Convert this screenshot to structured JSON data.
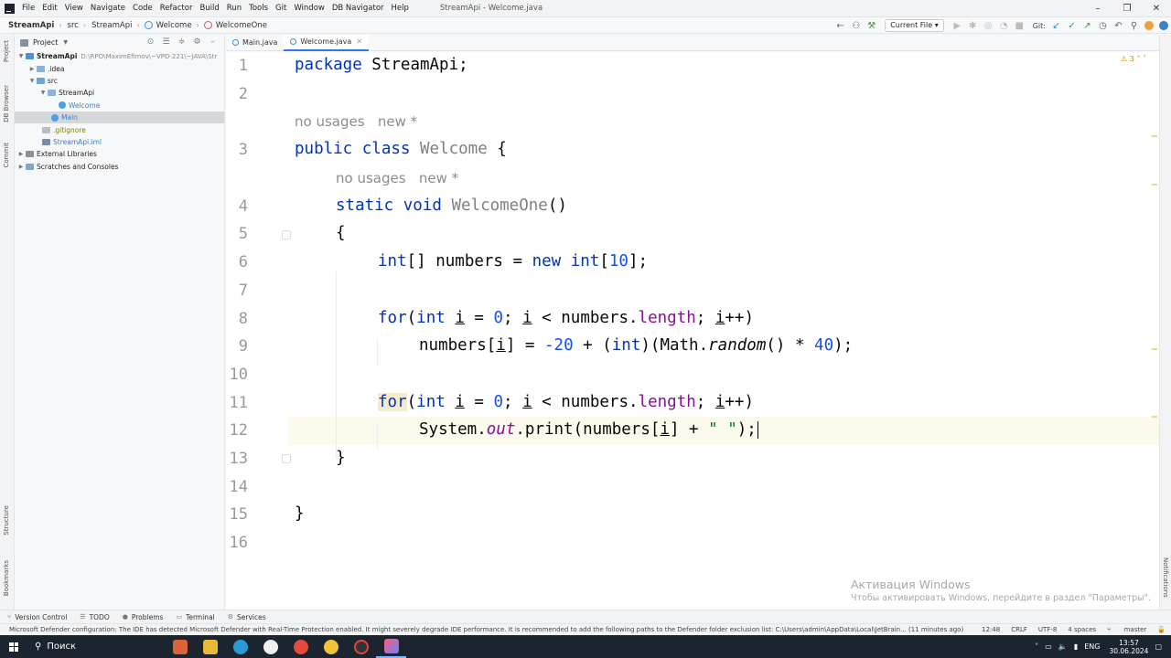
{
  "menubar": {
    "items": [
      "File",
      "Edit",
      "View",
      "Navigate",
      "Code",
      "Refactor",
      "Build",
      "Run",
      "Tools",
      "Git",
      "Window",
      "DB Navigator",
      "Help"
    ],
    "window_title": "StreamApi - Welcome.java"
  },
  "navbar": {
    "crumbs": [
      "StreamApi",
      "src",
      "StreamApi",
      "Welcome",
      "WelcomeOne"
    ],
    "run_config": "Current File",
    "git_label": "Git:"
  },
  "left_strip": {
    "project": "Project",
    "db_browser": "DB Browser",
    "commit": "Commit",
    "structure": "Structure",
    "bookmarks": "Bookmarks"
  },
  "right_strip": {
    "notifications": "Notifications"
  },
  "project_panel": {
    "title": "Project",
    "tree": [
      {
        "label": "StreamApi",
        "path": "D:\\RPO\\MaximEfimov\\~VPD-221\\~JAVA\\Str"
      },
      {
        "label": ".idea"
      },
      {
        "label": "src"
      },
      {
        "label": "StreamApi"
      },
      {
        "label": "Welcome"
      },
      {
        "label": "Main"
      },
      {
        "label": ".gitignore"
      },
      {
        "label": "StreamApi.iml"
      },
      {
        "label": "External Libraries"
      },
      {
        "label": "Scratches and Consoles"
      }
    ]
  },
  "tabs": [
    {
      "label": "Main.java"
    },
    {
      "label": "Welcome.java"
    }
  ],
  "editor": {
    "warning_count": "3",
    "line_numbers": [
      "1",
      "2",
      "3",
      "4",
      "5",
      "6",
      "7",
      "8",
      "9",
      "10",
      "11",
      "12",
      "13",
      "14",
      "15",
      "16"
    ],
    "hints": {
      "class_usages": "no usages",
      "class_new": "new *",
      "method_usages": "no usages",
      "method_new": "new *"
    },
    "tokens": {
      "package_kw": "package",
      "package_name": " StreamApi;",
      "public_kw": "public",
      "class_kw": "class",
      "class_name": "Welcome",
      "class_brace": " {",
      "static_kw": "static",
      "void_kw": "void",
      "method_name": "WelcomeOne",
      "parens": "()",
      "open_brace": "{",
      "int_kw": "int",
      "arr_decl": "[] numbers = ",
      "new_kw": "new",
      "int_kw2": "int",
      "arr_size_open": "[",
      "arr_size": "10",
      "arr_size_close": "];",
      "for_kw": "for",
      "paren_open": "(",
      "var_i": "i",
      "eq": " = ",
      "zero": "0",
      "semi_sp": "; ",
      "lt": " < numbers.",
      "length": "length",
      "inc_close": "++)",
      "numbers_idx": "numbers[",
      "idx_close": "] = ",
      "neg20": "-20",
      "plus": " + (",
      "cast_close": ")(Math.",
      "random": "random",
      "times": "() * ",
      "forty": "40",
      "end": ");",
      "system": "System.",
      "out": "out",
      "print": ".print(numbers[",
      "print_mid": "] + ",
      "space_str": "\" \"",
      "print_end": ");",
      "close_brace": "}"
    }
  },
  "watermark": {
    "line1": "Активация Windows",
    "line2": "Чтобы активировать Windows, перейдите в раздел \"Параметры\"."
  },
  "bottom_tabs": [
    "Version Control",
    "TODO",
    "Problems",
    "Terminal",
    "Services"
  ],
  "statusbar": {
    "message": "Microsoft Defender configuration: The IDE has detected Microsoft Defender with Real-Time Protection enabled. It might severely degrade IDE performance. It is recommended to add the following paths to the Defender folder exclusion list: C:\\Users\\admin\\AppData\\Local\\JetBrain... (11 minutes ago)",
    "position": "12:48",
    "line_sep": "CRLF",
    "encoding": "UTF-8",
    "indent": "4 spaces",
    "branch": "master"
  },
  "taskbar": {
    "search": "Поиск",
    "lang": "ENG",
    "time": "13:57",
    "date": "30.06.2024"
  }
}
